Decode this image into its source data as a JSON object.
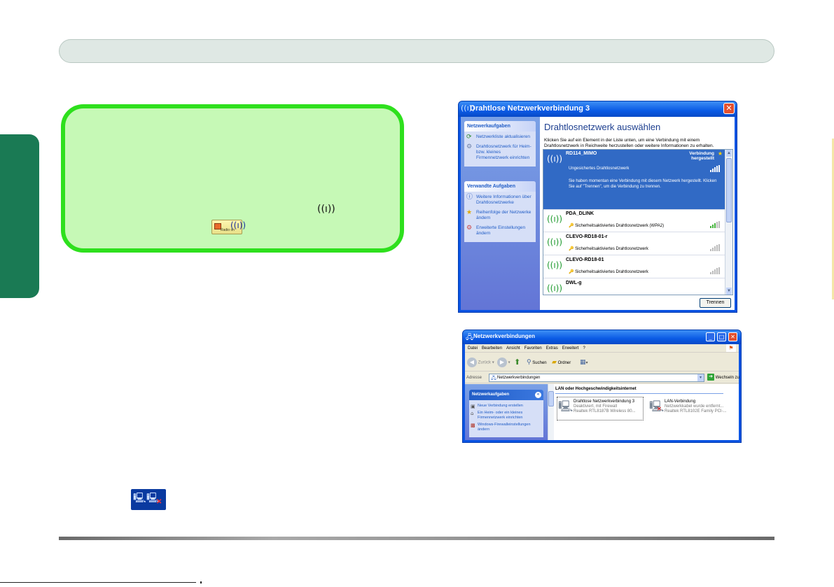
{
  "dialog1": {
    "title": "Drahtlose Netzwerkverbindung 3",
    "close_glyph": "✕",
    "panel1": {
      "header": "Netzwerkaufgaben",
      "items": [
        "Netzwerkliste aktualisieren",
        "Drahtlosnetzwerk für Heim- bzw. kleines Firmennetzwerk einrichten"
      ]
    },
    "panel2": {
      "header": "Verwandte Aufgaben",
      "items": [
        "Weitere Informationen über Drahtlosnetzwerke",
        "Reihenfolge der Netzwerke ändern",
        "Erweiterte Einstellungen ändern"
      ]
    },
    "heading": "Drahtlosnetzwerk auswählen",
    "description": "Klicken Sie auf ein Element in der Liste unten, um eine Verbindung mit einem Drahtlosnetzwerk in Reichweite herzustellen oder weitere Informationen zu erhalten.",
    "networks": [
      {
        "ssid": "RD114_MIMO",
        "status": "Verbindung hergestellt",
        "security": "Ungesichertes Drahtlosnetzwerk",
        "message": "Sie haben momentan eine Verbindung mit diesem Netzwerk hergestellt. Klicken Sie auf \"Trennen\", um die Verbindung zu trennen."
      },
      {
        "ssid": "PDA_DLINK",
        "security": "Sicherheitsaktiviertes Drahtlosnetzwerk (WPA2)"
      },
      {
        "ssid": "CLEVO-RD18-01-r",
        "security": "Sicherheitsaktiviertes Drahtlosnetzwerk"
      },
      {
        "ssid": "CLEVO-RD18-01",
        "security": "Sicherheitsaktiviertes Drahtlosnetzwerk"
      },
      {
        "ssid": "DWL-g",
        "security": ""
      }
    ],
    "disconnect_button": "Trennen"
  },
  "dialog2": {
    "title": "Netzwerkverbindungen",
    "menu": [
      "Datei",
      "Bearbeiten",
      "Ansicht",
      "Favoriten",
      "Extras",
      "Erweitert",
      "?"
    ],
    "toolbar": {
      "back": "Zurück",
      "search": "Suchen",
      "folders": "Ordner"
    },
    "address_label": "Adresse",
    "address_value": "Netzwerkverbindungen",
    "go_label": "Wechseln zu",
    "panel": {
      "header": "Netzwerkaufgaben",
      "items": [
        "Neue Verbindung erstellen",
        "Ein Heim- oder ein kleines Firmennetzwerk einrichten",
        "Windows-Firewalleinstellungen ändern"
      ]
    },
    "group_header": "LAN oder Hochgeschwindigkeitsinternet",
    "connections": [
      {
        "name": "Drahtlose Netzwerkverbindung 3",
        "status": "Deaktiviert, mit Firewall",
        "device": "Realtek RTL8187B Wireless 80..."
      },
      {
        "name": "LAN-Verbindung",
        "status": "Netzwerkkabel wurde entfernt...",
        "device": "Realtek RTL8102E Family PCI-..."
      }
    ]
  },
  "icons": {
    "antenna_glyph": "((ı))",
    "radio_label": "Radio on",
    "tray": "network-disconnected"
  },
  "colors": {
    "note_fill": "#c6f9b6",
    "note_border": "#2ee01d",
    "side_tab": "#1a7a54",
    "xp_blue": "#0a54e3"
  }
}
